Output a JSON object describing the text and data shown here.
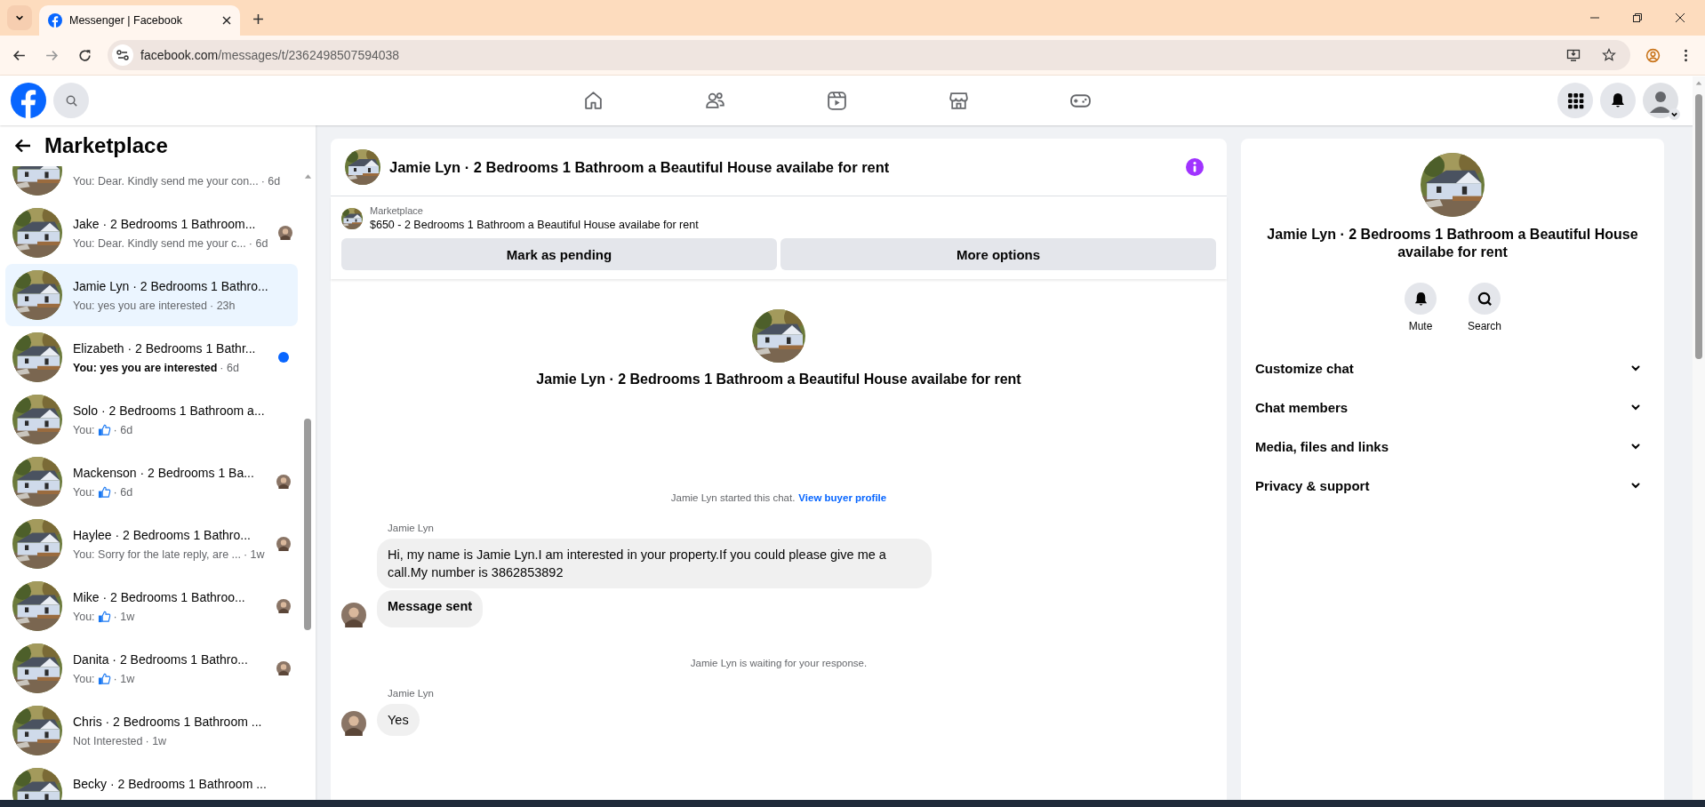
{
  "browser": {
    "tab_title": "Messenger | Facebook",
    "url_domain": "facebook.com",
    "url_path": "/messages/t/2362498507594038"
  },
  "sidebar": {
    "title": "Marketplace",
    "conversations": [
      {
        "preview": {
          "kind": "text",
          "text": "You: Dear. Kindly send me your con...",
          "time": "· 6d"
        },
        "unread": false,
        "selected": false
      },
      {
        "name": "Jake · 2 Bedrooms 1 Bathroom...",
        "preview": {
          "kind": "text",
          "text": "You: Dear. Kindly send me your c...",
          "time": "· 6d"
        },
        "unread": false,
        "selected": false,
        "seen": true
      },
      {
        "name": "Jamie Lyn · 2 Bedrooms 1 Bathro...",
        "preview": {
          "kind": "text",
          "text": "You: yes you are interested",
          "time": "· 23h"
        },
        "unread": false,
        "selected": true
      },
      {
        "name": "Elizabeth · 2 Bedrooms 1 Bathr...",
        "preview": {
          "kind": "text",
          "text": "You: yes you are interested",
          "time": "· 6d"
        },
        "unread": true,
        "selected": false
      },
      {
        "name": "Solo · 2 Bedrooms 1 Bathroom a...",
        "preview": {
          "kind": "like",
          "text": "You:",
          "time": "· 6d"
        },
        "unread": false,
        "selected": false
      },
      {
        "name": "Mackenson · 2 Bedrooms 1 Ba...",
        "preview": {
          "kind": "like",
          "text": "You:",
          "time": "· 6d"
        },
        "unread": false,
        "selected": false,
        "seen": true
      },
      {
        "name": "Haylee · 2 Bedrooms 1 Bathro...",
        "preview": {
          "kind": "text",
          "text": "You: Sorry for the late reply, are ...",
          "time": "· 1w"
        },
        "unread": false,
        "selected": false,
        "seen": true
      },
      {
        "name": "Mike · 2 Bedrooms 1 Bathroo...",
        "preview": {
          "kind": "like",
          "text": "You:",
          "time": "· 1w"
        },
        "unread": false,
        "selected": false,
        "seen": true
      },
      {
        "name": "Danita · 2 Bedrooms 1 Bathro...",
        "preview": {
          "kind": "like",
          "text": "You:",
          "time": "· 1w"
        },
        "unread": false,
        "selected": false,
        "seen": true
      },
      {
        "name": "Chris · 2 Bedrooms 1 Bathroom ...",
        "preview": {
          "kind": "text",
          "text": "Not Interested",
          "time": "· 1w"
        },
        "unread": false,
        "selected": false
      },
      {
        "name": "Becky · 2 Bedrooms 1 Bathroom ...",
        "unread": false,
        "selected": false
      }
    ]
  },
  "chat": {
    "title": "Jamie Lyn · 2 Bedrooms 1 Bathroom a Beautiful House availabe for rent",
    "listing": {
      "label": "Marketplace",
      "text": "$650 - 2 Bedrooms 1 Bathroom a Beautiful House availabe for rent"
    },
    "actions": [
      "Mark as pending",
      "More options"
    ],
    "intro_title": "Jamie Lyn · 2 Bedrooms 1 Bathroom a Beautiful House availabe for rent",
    "events": [
      {
        "kind": "notice",
        "text": "Jamie Lyn started this chat.",
        "link": "View buyer profile"
      },
      {
        "kind": "message",
        "sender": "Jamie Lyn",
        "bubbles": [
          {
            "kind": "text",
            "text": "Hi, my name is Jamie Lyn.I am interested in your property.If you could please give me a call.My number is 3862853892"
          },
          {
            "kind": "status",
            "text": "Message sent"
          }
        ]
      },
      {
        "kind": "notice",
        "text": "Jamie Lyn is waiting for your response."
      },
      {
        "kind": "message",
        "sender": "Jamie Lyn",
        "bubbles": [
          {
            "kind": "text",
            "text": "Yes"
          }
        ]
      }
    ]
  },
  "details": {
    "title": "Jamie Lyn · 2 Bedrooms 1 Bathroom a Beautiful House availabe for rent",
    "actions": [
      {
        "kind": "mute",
        "label": "Mute"
      },
      {
        "kind": "search",
        "label": "Search"
      }
    ],
    "sections": [
      {
        "label": "Customize chat",
        "expanded": false
      },
      {
        "label": "Chat members",
        "expanded": false
      },
      {
        "label": "Media, files and links",
        "expanded": false
      },
      {
        "label": "Privacy & support",
        "expanded": false
      }
    ]
  }
}
